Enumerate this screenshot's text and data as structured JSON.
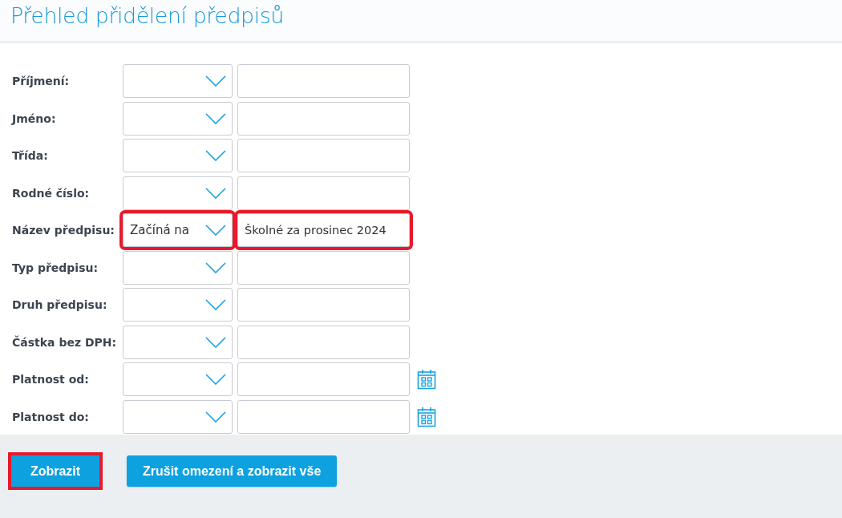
{
  "title": "Přehled přidělení předpisů",
  "rows": [
    {
      "label": "Příjmení:",
      "operator": "",
      "value": "",
      "kind": "text",
      "highlighted": false
    },
    {
      "label": "Jméno:",
      "operator": "",
      "value": "",
      "kind": "text",
      "highlighted": false
    },
    {
      "label": "Třída:",
      "operator": "",
      "value": "",
      "kind": "text",
      "highlighted": false
    },
    {
      "label": "Rodné číslo:",
      "operator": "",
      "value": "",
      "kind": "text",
      "highlighted": false
    },
    {
      "label": "Název předpisu:",
      "operator": "Začíná na",
      "value": "Školné za prosinec 2024",
      "kind": "text",
      "highlighted": true
    },
    {
      "label": "Typ předpisu:",
      "operator": "",
      "value": "",
      "kind": "text",
      "highlighted": false
    },
    {
      "label": "Druh předpisu:",
      "operator": "",
      "value": "",
      "kind": "text",
      "highlighted": false
    },
    {
      "label": "Částka bez DPH:",
      "operator": "",
      "value": "",
      "kind": "text",
      "highlighted": false
    },
    {
      "label": "Platnost od:",
      "operator": "",
      "value": "",
      "kind": "date",
      "highlighted": false
    },
    {
      "label": "Platnost do:",
      "operator": "",
      "value": "",
      "kind": "date",
      "highlighted": false
    }
  ],
  "buttons": [
    {
      "label": "Zobrazit",
      "highlighted": true
    },
    {
      "label": "Zrušit omezení a zobrazit vše",
      "highlighted": false
    }
  ]
}
